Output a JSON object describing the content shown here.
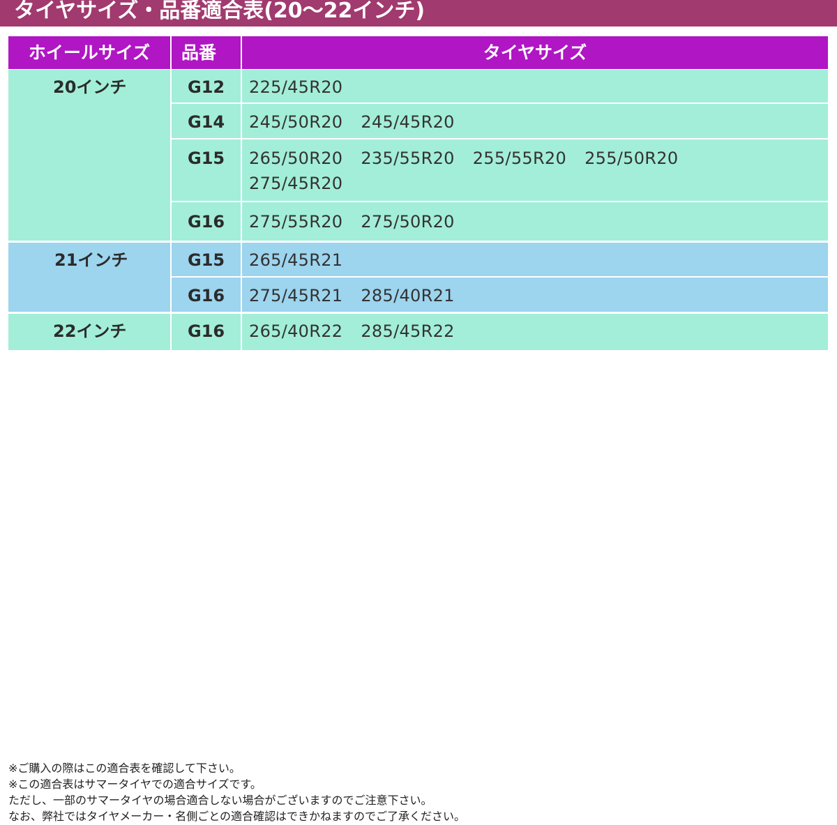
{
  "title": "タイヤサイズ・品番適合表(20〜22インチ)",
  "colors": {
    "title_bg": "#a13a6e",
    "header_bg": "#b016c4",
    "green_band": "#a3eed8",
    "blue_band": "#9dd4ee"
  },
  "table": {
    "headers": {
      "wheel": "ホイールサイズ",
      "part": "品番",
      "tire": "タイヤサイズ"
    },
    "groups": [
      {
        "wheel": "20インチ",
        "rows": [
          {
            "part": "G12",
            "sizes": [
              "225/45R20"
            ]
          },
          {
            "part": "G14",
            "sizes": [
              "245/50R20",
              "245/45R20"
            ]
          },
          {
            "part": "G15",
            "sizes": [
              "265/50R20",
              "235/55R20",
              "255/55R20",
              "255/50R20",
              "275/45R20"
            ]
          },
          {
            "part": "G16",
            "sizes": [
              "275/55R20",
              "275/50R20"
            ]
          }
        ]
      },
      {
        "wheel": "21インチ",
        "rows": [
          {
            "part": "G15",
            "sizes": [
              "265/45R21"
            ]
          },
          {
            "part": "G16",
            "sizes": [
              "275/45R21",
              "285/40R21"
            ]
          }
        ]
      },
      {
        "wheel": "22インチ",
        "rows": [
          {
            "part": "G16",
            "sizes": [
              "265/40R22",
              "285/45R22"
            ]
          }
        ]
      }
    ]
  },
  "notes": [
    "※ご購入の際はこの適合表を確認して下さい。",
    "※この適合表はサマータイヤでの適合サイズです。",
    "ただし、一部のサマータイヤの場合適合しない場合がございますのでご注意下さい。",
    "なお、弊社ではタイヤメーカー・名側ごとの適合確認はできかねますのでご了承ください。"
  ]
}
